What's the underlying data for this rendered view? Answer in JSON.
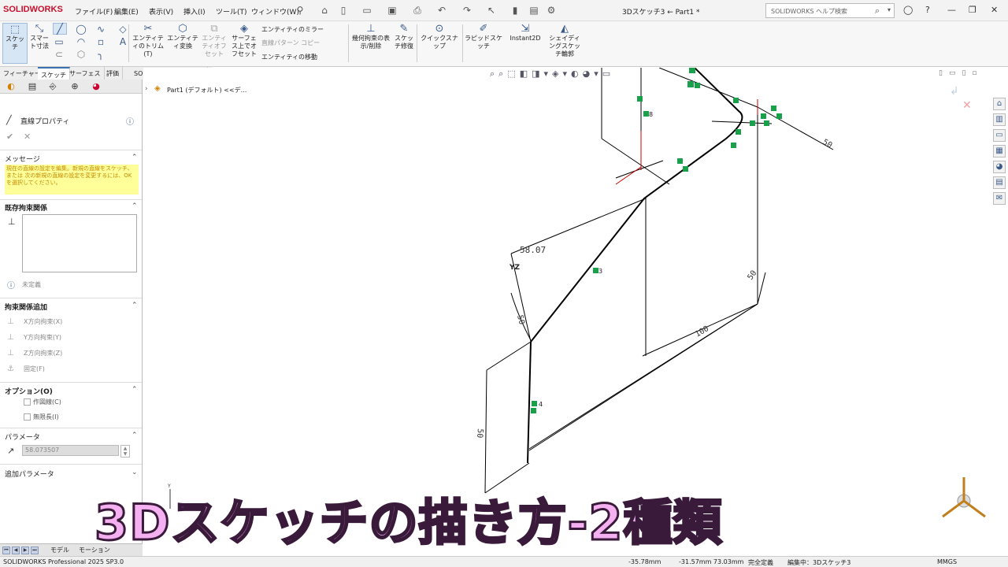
{
  "app": {
    "logo": "SOLIDWORKS",
    "doc_title": "3Dスケッチ3 ← Part1 *"
  },
  "menu": [
    "ファイル(F)",
    "編集(E)",
    "表示(V)",
    "挿入(I)",
    "ツール(T)",
    "ウィンドウ(W)"
  ],
  "search": {
    "placeholder": "SOLIDWORKS ヘルプ検索"
  },
  "ribbon": {
    "sketch": "スケッチ",
    "smart_dim": "スマート寸法",
    "trim": "エンティティのトリム(T)",
    "convert": "エンティティ変換",
    "offset": "エンティティオフセット",
    "surface_offset": "サーフェス上でオフセット",
    "mirror": "エンティティのミラー",
    "linear_pattern": "直線パターン コピー",
    "move": "エンティティの移動",
    "relations": "幾何拘束の表示/削除",
    "repair": "スケッチ修復",
    "quick_snap": "クイックスナップ",
    "rapid_sketch": "ラピッドスケッチ",
    "instant2d": "Instant2D",
    "shaded_sketch": "シェイディングスケッチ輪郭"
  },
  "tabs": [
    "フィーチャー",
    "スケッチ",
    "サーフェス",
    "評価",
    "SOLIDWORKS アドイン"
  ],
  "left_panel": {
    "title": "直線プロパティ",
    "message_header": "メッセージ",
    "message": "現在の直線の設定を編集。新規の直線をスケッチ、または 次の新規の直線の設定を変更するには、OKを選択してください。",
    "existing_header": "既存拘束関係",
    "status": "未定義",
    "add_header": "拘束関係追加",
    "relations": [
      "X方向拘束(X)",
      "Y方向拘束(Y)",
      "Z方向拘束(Z)",
      "固定(F)"
    ],
    "options_header": "オプション(O)",
    "options": [
      "作図線(C)",
      "無限長(I)"
    ],
    "params_header": "パラメータ",
    "param_value": "58.073507",
    "extra_header": "追加パラメータ"
  },
  "tree": {
    "root": "Part1 (デフォルト) <<デ..."
  },
  "dimensions": {
    "d1": "58.07",
    "d2": "50",
    "d3": "100",
    "d4": "50",
    "d5": "50",
    "d6": "50"
  },
  "sketch_labels": {
    "yz": "YZ",
    "l3": "3",
    "l4": "4",
    "l8": "8"
  },
  "bottom_tabs": [
    "モデル",
    "モーション"
  ],
  "status": {
    "product": "SOLIDWORKS Professional 2025 SP3.0",
    "x": "-35.78mm",
    "yz": "-31.57mm 73.03mm",
    "state": "完全定義",
    "editing": "編集中：3Dスケッチ3",
    "units": "MMGS"
  },
  "banner": "3Dスケッチの描き方-2種類"
}
